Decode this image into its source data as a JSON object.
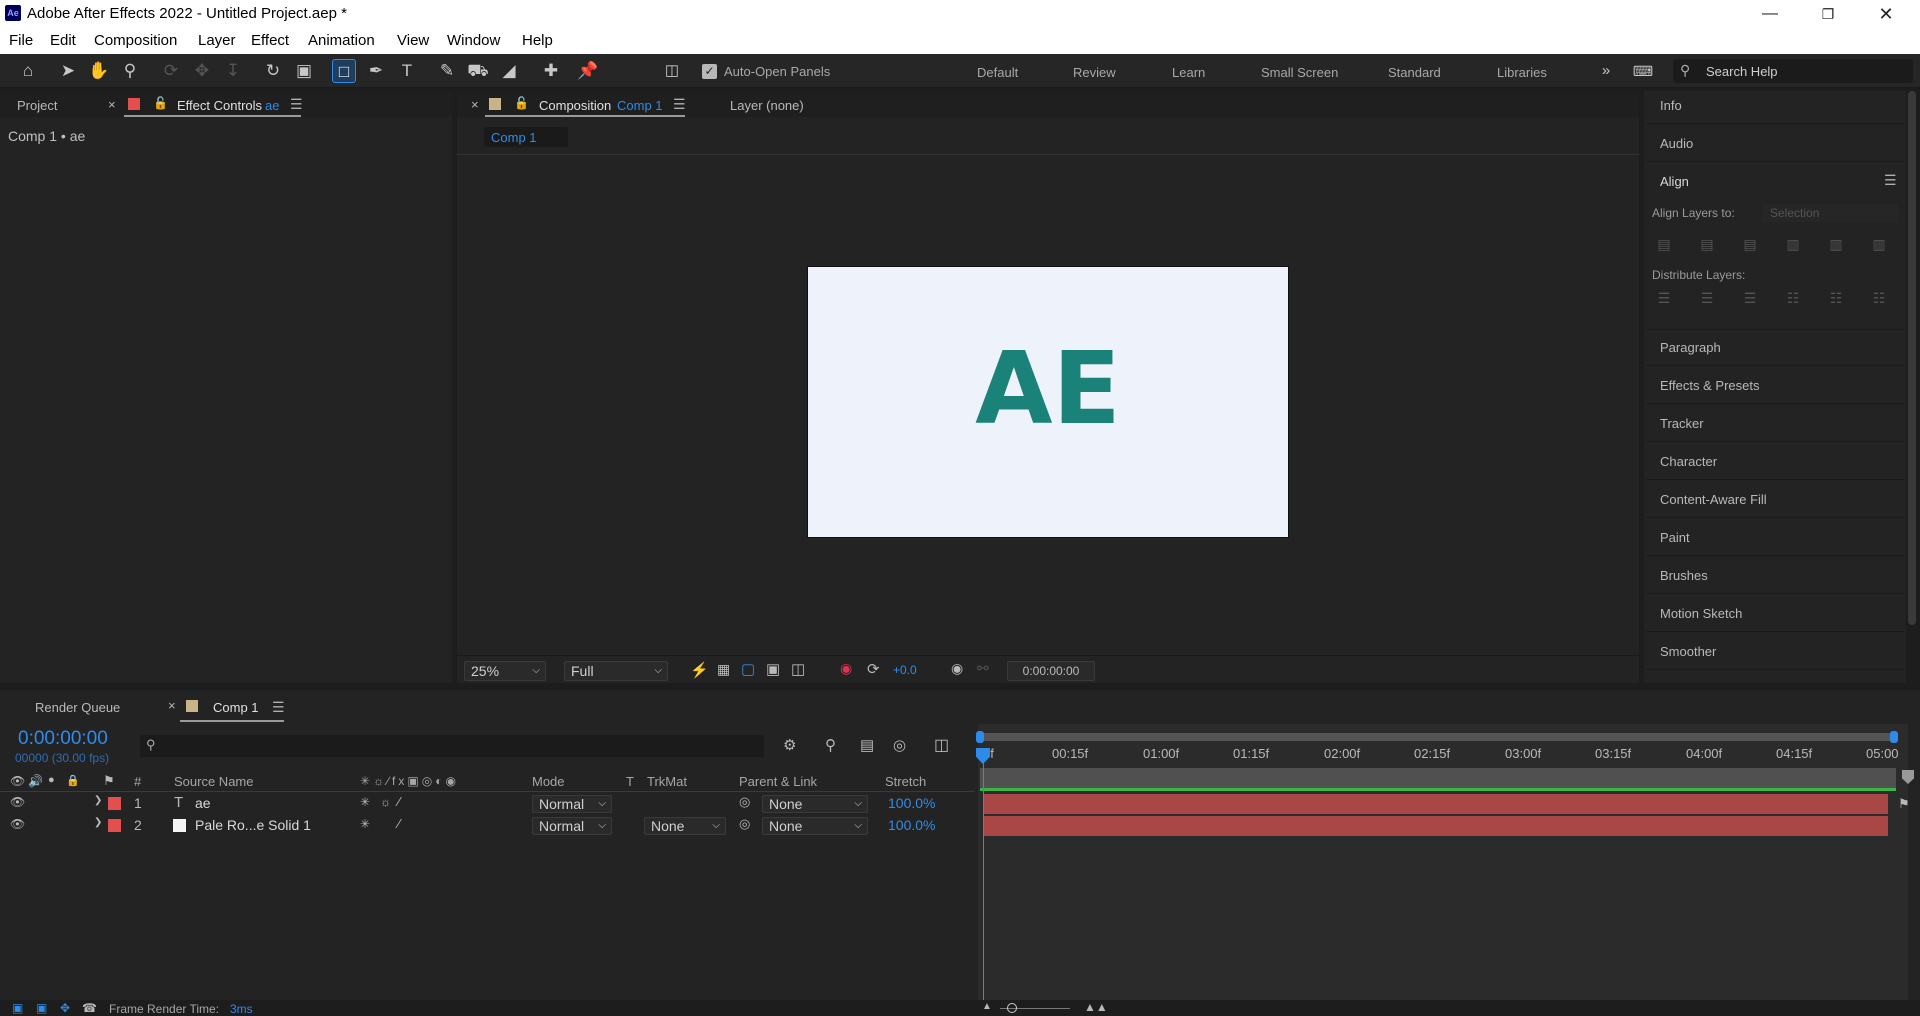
{
  "window": {
    "title": "Adobe After Effects 2022 - Untitled Project.aep *",
    "app_icon": "Ae"
  },
  "menu": [
    "File",
    "Edit",
    "Composition",
    "Layer",
    "Effect",
    "Animation",
    "View",
    "Window",
    "Help"
  ],
  "toolbar": {
    "auto_open_label": "Auto-Open Panels",
    "workspaces": [
      "Default",
      "Review",
      "Learn",
      "Small Screen",
      "Standard",
      "Libraries"
    ],
    "search_placeholder": "Search Help"
  },
  "left_panel": {
    "tab_project": "Project",
    "tab_effect_controls": "Effect Controls",
    "tab_effect_controls_layer": "ae",
    "breadcrumb": "Comp 1 • ae"
  },
  "viewer": {
    "tab_composition": "Composition",
    "tab_comp_name": "Comp 1",
    "tab_layer": "Layer (none)",
    "subtab": "Comp 1",
    "canvas_text": "AE",
    "zoom": "25%",
    "resolution": "Full",
    "exposure": "+0.0",
    "timecode": "0:00:00:00"
  },
  "right_panel": {
    "info": "Info",
    "audio": "Audio",
    "align": "Align",
    "align_layers_to": "Align Layers to:",
    "align_target": "Selection",
    "distribute_layers": "Distribute Layers:",
    "items": [
      "Paragraph",
      "Effects & Presets",
      "Tracker",
      "Character",
      "Content-Aware Fill",
      "Paint",
      "Brushes",
      "Motion Sketch",
      "Smoother"
    ]
  },
  "timeline": {
    "tab_render_queue": "Render Queue",
    "tab_comp": "Comp 1",
    "current_time": "0:00:00:00",
    "frame_info": "00000 (30.00 fps)",
    "search_placeholder": "",
    "columns": {
      "hash": "#",
      "source_name": "Source Name",
      "mode": "Mode",
      "t": "T",
      "trkmat": "TrkMat",
      "parent": "Parent & Link",
      "stretch": "Stretch"
    },
    "ruler": [
      "0f",
      "00:15f",
      "01:00f",
      "01:15f",
      "02:00f",
      "02:15f",
      "03:00f",
      "03:15f",
      "04:00f",
      "04:15f",
      "05:00"
    ],
    "layers": [
      {
        "num": "1",
        "type_icon": "T",
        "name": "ae",
        "mode": "Normal",
        "trkmat": "",
        "parent": "None",
        "stretch": "100.0%",
        "label_color": "#e34f4f"
      },
      {
        "num": "2",
        "type_icon": "solid",
        "name": "Pale Ro...e Solid 1",
        "mode": "Normal",
        "trkmat": "None",
        "parent": "None",
        "stretch": "100.0%",
        "label_color": "#e34f4f"
      }
    ],
    "status_label": "Frame Render Time:",
    "status_value": "3ms"
  },
  "colors": {
    "accent": "#2d8ceb",
    "canvas_bg": "#eef2fa",
    "canvas_text": "#1a8278",
    "layer_bar": "#a94646",
    "label_red": "#e34f4f",
    "comp_swatch": "#c9b489"
  }
}
